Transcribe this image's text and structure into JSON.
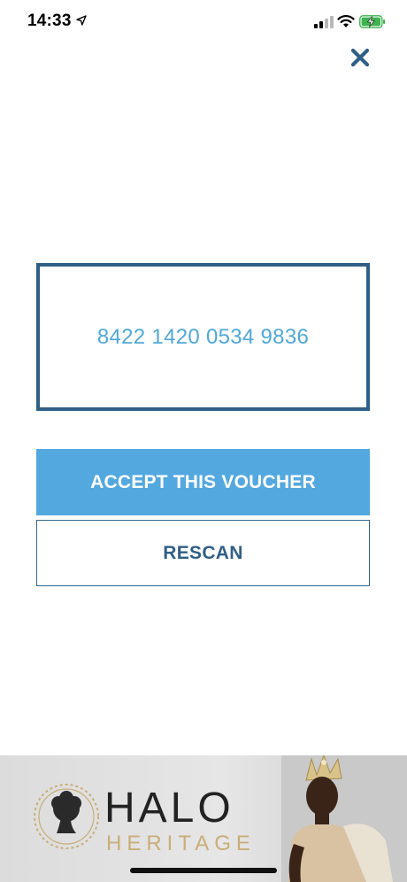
{
  "status_bar": {
    "time": "14:33",
    "icons": [
      "location-arrow-icon",
      "cellular-signal-icon",
      "wifi-icon",
      "battery-charging-icon"
    ]
  },
  "close": {
    "icon": "close-icon"
  },
  "voucher": {
    "code": "8422 1420 0534 9836"
  },
  "actions": {
    "accept_label": "ACCEPT THIS VOUCHER",
    "rescan_label": "RESCAN"
  },
  "ad": {
    "brand": "HALO",
    "sub_brand": "HERITAGE"
  },
  "colors": {
    "primary_blue": "#53a8e0",
    "dark_blue": "#2f5f86",
    "code_text": "#4ea8d9",
    "gold": "#c9ae78"
  }
}
